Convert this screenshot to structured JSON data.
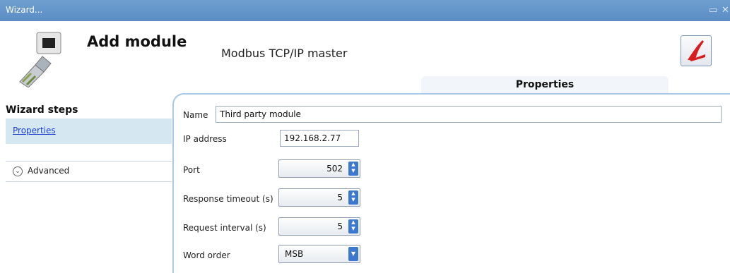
{
  "window": {
    "title": "Wizard...",
    "restore_icon": "restore-icon",
    "close_icon": "close-icon"
  },
  "header": {
    "title": "Add module",
    "subtitle": "Modbus TCP/IP master",
    "logo_icon": "network-plug-icon",
    "pdf_icon": "pdf-icon"
  },
  "tab": {
    "label": "Properties"
  },
  "sidebar": {
    "heading": "Wizard steps",
    "items": [
      {
        "label": "Properties"
      }
    ],
    "advanced_label": "Advanced"
  },
  "form": {
    "name": {
      "label": "Name",
      "value": "Third party module"
    },
    "ip": {
      "label": "IP address",
      "value": "192.168.2.77"
    },
    "port": {
      "label": "Port",
      "value": "502"
    },
    "response_timeout": {
      "label": "Response timeout (s)",
      "value": "5"
    },
    "request_interval": {
      "label": "Request interval (s)",
      "value": "5"
    },
    "word_order": {
      "label": "Word order",
      "value": "MSB"
    }
  },
  "colors": {
    "titlebar": "#5b8cc3",
    "accent": "#3c78d0",
    "link": "#1e3fd0",
    "selected_step": "#d5e8f2"
  }
}
